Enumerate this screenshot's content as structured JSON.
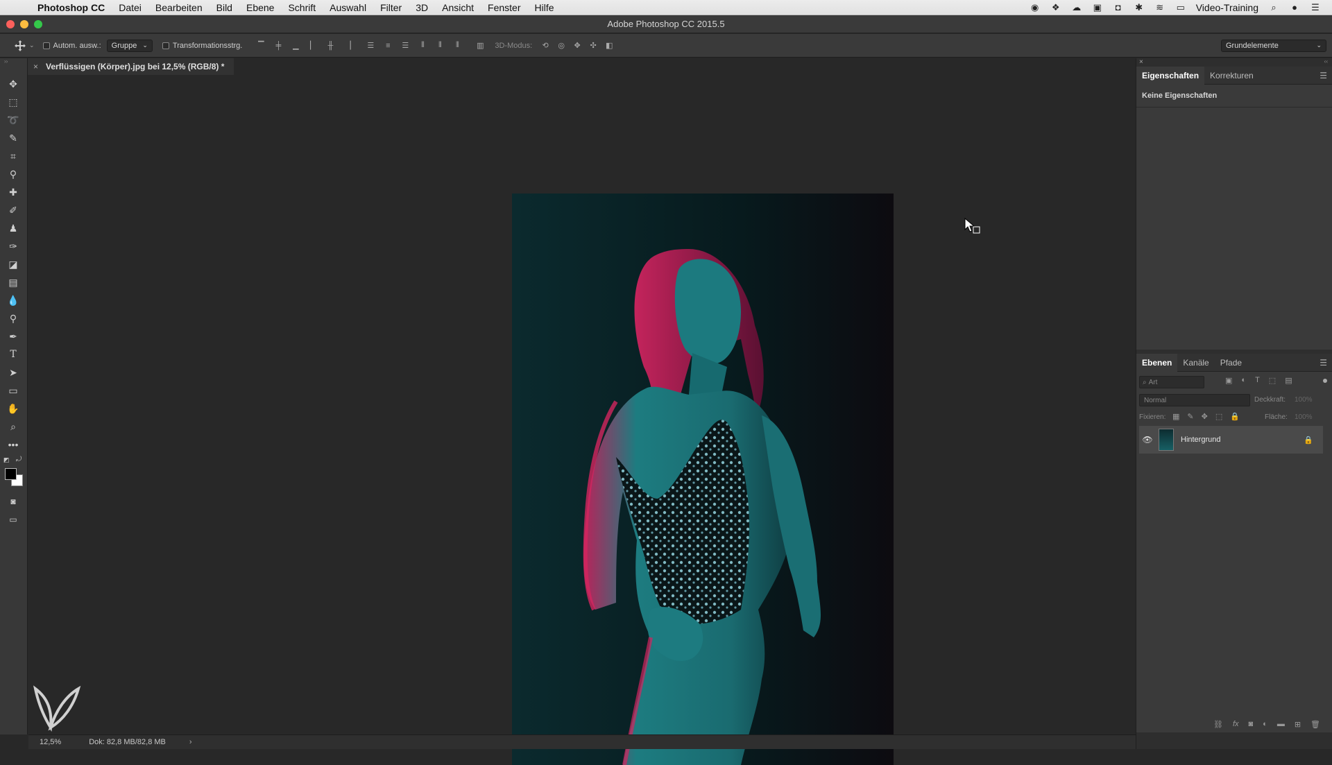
{
  "menubar": {
    "app": "Photoshop CC",
    "items": [
      "Datei",
      "Bearbeiten",
      "Bild",
      "Ebene",
      "Schrift",
      "Auswahl",
      "Filter",
      "3D",
      "Ansicht",
      "Fenster",
      "Hilfe"
    ],
    "user": "Video-Training"
  },
  "window": {
    "title": "Adobe Photoshop CC 2015.5"
  },
  "options": {
    "auto_select_label": "Autom. ausw.:",
    "auto_select_value": "Gruppe",
    "transform_label": "Transformationsstrg.",
    "mode_3d": "3D-Modus:",
    "workspace": "Grundelemente"
  },
  "document": {
    "tab_title": "Verflüssigen (Körper).jpg bei 12,5% (RGB/8) *"
  },
  "status": {
    "zoom": "12,5%",
    "doc_size": "Dok: 82,8 MB/82,8 MB"
  },
  "properties_panel": {
    "tabs": [
      "Eigenschaften",
      "Korrekturen"
    ],
    "content": "Keine Eigenschaften"
  },
  "layers_panel": {
    "tabs": [
      "Ebenen",
      "Kanäle",
      "Pfade"
    ],
    "filter_placeholder": "Art",
    "blend_mode": "Normal",
    "opacity_label": "Deckkraft:",
    "opacity_value": "100%",
    "lock_label": "Fixieren:",
    "fill_label": "Fläche:",
    "fill_value": "100%",
    "layers": [
      {
        "name": "Hintergrund",
        "visible": true,
        "locked": true
      }
    ]
  },
  "colors": {
    "accent_cyan": "#1e8c8c",
    "accent_magenta": "#d2255f"
  }
}
